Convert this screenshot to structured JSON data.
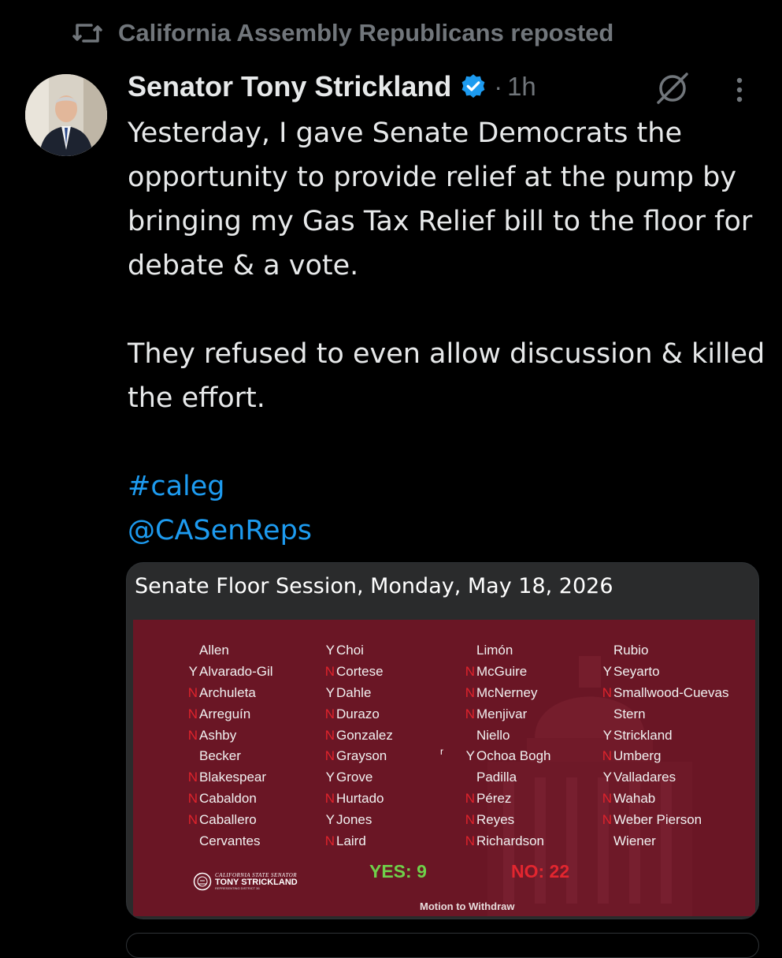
{
  "repost": {
    "text": "California Assembly Republicans reposted",
    "icon": "repost-icon"
  },
  "tweet": {
    "author_name": "Senator Tony Strickland",
    "dot": "·",
    "time": "1h",
    "icons": [
      "verified-badge-icon",
      "grok-icon",
      "more-options-icon"
    ],
    "paragraphs": [
      "Yesterday, I gave Senate Democrats the opportunity to provide relief at the pump by bringing my Gas Tax Relief bill to the floor for debate & a vote.",
      "They refused to even allow discussion & killed the effort."
    ],
    "hashtag": "#caleg",
    "mention": "@CASenReps"
  },
  "media": {
    "title": "Senate Floor Session, Monday, May 18, 2026",
    "columns": [
      [
        {
          "mark": "",
          "name": "Allen"
        },
        {
          "mark": "Y",
          "name": "Alvarado-Gil"
        },
        {
          "mark": "N",
          "name": "Archuleta"
        },
        {
          "mark": "N",
          "name": "Arreguín"
        },
        {
          "mark": "N",
          "name": "Ashby"
        },
        {
          "mark": "",
          "name": "Becker"
        },
        {
          "mark": "N",
          "name": "Blakespear"
        },
        {
          "mark": "N",
          "name": "Cabaldon"
        },
        {
          "mark": "N",
          "name": "Caballero"
        },
        {
          "mark": "",
          "name": "Cervantes"
        }
      ],
      [
        {
          "mark": "Y",
          "name": "Choi"
        },
        {
          "mark": "N",
          "name": "Cortese"
        },
        {
          "mark": "Y",
          "name": "Dahle"
        },
        {
          "mark": "N",
          "name": "Durazo"
        },
        {
          "mark": "N",
          "name": "Gonzalez"
        },
        {
          "mark": "N",
          "name": "Grayson"
        },
        {
          "mark": "Y",
          "name": "Grove"
        },
        {
          "mark": "N",
          "name": "Hurtado"
        },
        {
          "mark": "Y",
          "name": "Jones"
        },
        {
          "mark": "N",
          "name": "Laird"
        }
      ],
      [
        {
          "mark": "",
          "name": "Limón"
        },
        {
          "mark": "N",
          "name": "McGuire"
        },
        {
          "mark": "N",
          "name": "McNerney"
        },
        {
          "mark": "N",
          "name": "Menjivar"
        },
        {
          "mark": "",
          "name": "Niello"
        },
        {
          "mark": "Y",
          "name": "Ochoa Bogh"
        },
        {
          "mark": "",
          "name": "Padilla"
        },
        {
          "mark": "N",
          "name": "Pérez"
        },
        {
          "mark": "N",
          "name": "Reyes"
        },
        {
          "mark": "N",
          "name": "Richardson"
        }
      ],
      [
        {
          "mark": "",
          "name": "Rubio"
        },
        {
          "mark": "Y",
          "name": "Seyarto"
        },
        {
          "mark": "N",
          "name": "Smallwood-Cuevas"
        },
        {
          "mark": "",
          "name": "Stern"
        },
        {
          "mark": "Y",
          "name": "Strickland"
        },
        {
          "mark": "N",
          "name": "Umberg"
        },
        {
          "mark": "Y",
          "name": "Valladares"
        },
        {
          "mark": "N",
          "name": "Wahab"
        },
        {
          "mark": "N",
          "name": "Weber Pierson"
        },
        {
          "mark": "",
          "name": "Wiener"
        }
      ]
    ],
    "yes_label": "YES:  9",
    "no_label": "NO:  22",
    "motion": "Motion to Withdraw",
    "logo_line1": "CALIFORNIA STATE SENATOR",
    "logo_line2": "TONY STRICKLAND",
    "logo_line3": "REPRESENTING DISTRICT 36",
    "stray_mark": "r",
    "colors": {
      "yes": "#6fd14a",
      "no": "#e3262f",
      "board": "#6a1625"
    }
  },
  "theme": {
    "background": "#000000",
    "text": "#e7e9ea",
    "secondary": "#71767b",
    "link": "#1d9bf0"
  }
}
